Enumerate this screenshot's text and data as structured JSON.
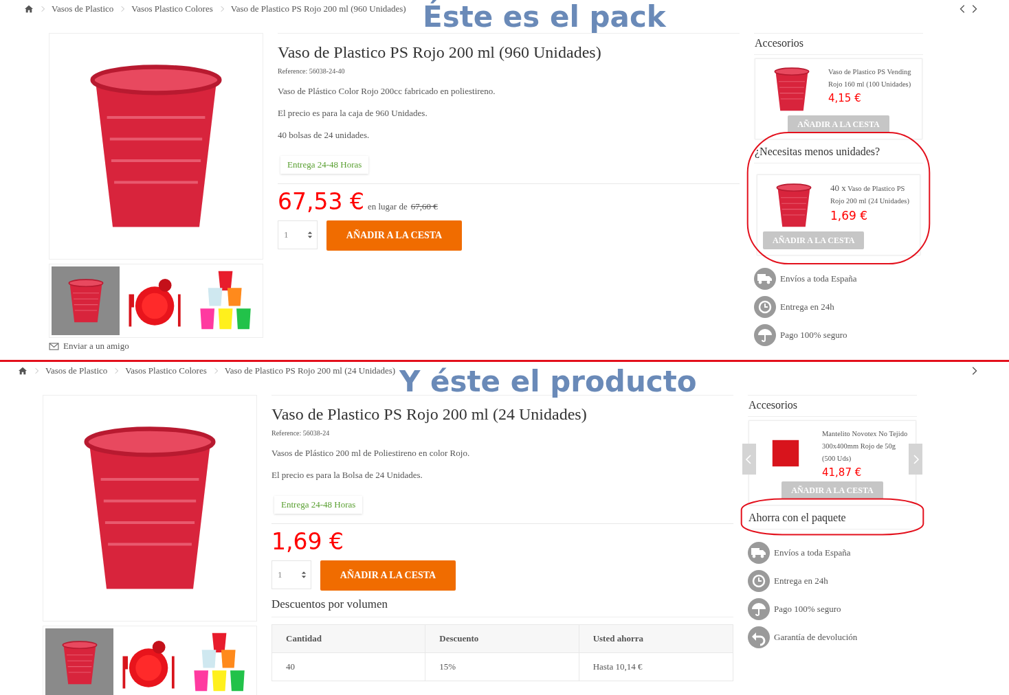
{
  "pages": [
    {
      "breadcrumb": [
        "Vasos de Plastico",
        "Vasos Plastico Colores",
        "Vaso de Plastico PS Rojo 200 ml (960 Unidades)"
      ],
      "nav": {
        "prev": true,
        "next": true
      },
      "annotation": "Éste es el pack",
      "thumbnails": [
        {
          "kind": "cup",
          "selected": true
        },
        {
          "kind": "plate",
          "selected": false
        },
        {
          "kind": "cups",
          "selected": false
        }
      ],
      "send_to_friend": "Enviar a un amigo",
      "product": {
        "title": "Vaso de Plastico PS Rojo 200 ml (960 Unidades)",
        "reference": "Reference: 56038-24-40",
        "description": [
          "Vaso de Plástico Color Rojo 200cc fabricado en poliestireno.",
          "El precio es para la caja de 960 Unidades.",
          "40 bolsas de 24 unidades."
        ],
        "delivery": "Entrega 24-48 Horas",
        "price": "67,53 €",
        "old_price_label": "en lugar de",
        "old_price": "67,60 €",
        "quantity": "1",
        "add_button": "AÑADIR A LA CESTA"
      },
      "sidebar": {
        "accessories_title": "Accesorios",
        "carousel_arrows": false,
        "accessory": {
          "kind": "cup",
          "name": "Vaso de Plastico PS Vending Rojo 160 ml (100 Unidades)",
          "price": "4,15 €",
          "button": "AÑADIR A LA CESTA"
        },
        "pack": {
          "title": "¿Necesitas menos unidades?",
          "circled": true,
          "card": {
            "quantity": "40 x",
            "name": "Vaso de Plastico PS Rojo 200 ml (24 Unidades)",
            "price": "1,69 €",
            "button": "AÑADIR A LA CESTA"
          }
        },
        "features": [
          {
            "kind": "truck",
            "label": "Envíos a toda España"
          },
          {
            "kind": "clock",
            "label": "Entrega en 24h"
          },
          {
            "kind": "umbrella",
            "label": "Pago 100% seguro"
          }
        ]
      }
    },
    {
      "breadcrumb": [
        "Vasos de Plastico",
        "Vasos Plastico Colores",
        "Vaso de Plastico PS Rojo 200 ml (24 Unidades)"
      ],
      "nav": {
        "prev": false,
        "next": true
      },
      "annotation": "Y éste el producto",
      "thumbnails": [
        {
          "kind": "cup",
          "selected": true
        },
        {
          "kind": "plate",
          "selected": false
        },
        {
          "kind": "cups",
          "selected": false
        }
      ],
      "product": {
        "title": "Vaso de Plastico PS Rojo 200 ml (24 Unidades)",
        "reference": "Reference: 56038-24",
        "description": [
          "Vasos de Plástico 200 ml de Poliestireno en color Rojo.",
          "El precio es para la  Bolsa  de 24 Unidades."
        ],
        "delivery": "Entrega 24-48 Horas",
        "price": "1,69 €",
        "quantity": "1",
        "add_button": "AÑADIR A LA CESTA"
      },
      "volume_discounts": {
        "title": "Descuentos por volumen",
        "columns": [
          "Cantidad",
          "Descuento",
          "Usted ahorra"
        ],
        "rows": [
          [
            "40",
            "15%",
            "Hasta 10,14 €"
          ]
        ]
      },
      "sidebar": {
        "accessories_title": "Accesorios",
        "carousel_arrows": true,
        "accessory": {
          "kind": "napkin",
          "name": "Mantelito Novotex No Tejido 300x400mm Rojo de 50g (500 Uds)",
          "price": "41,87 €",
          "button": "AÑADIR A LA CESTA"
        },
        "pack": {
          "title": "Ahorra con el paquete",
          "circled": true
        },
        "features": [
          {
            "kind": "truck",
            "label": "Envíos a toda España"
          },
          {
            "kind": "clock",
            "label": "Entrega en 24h"
          },
          {
            "kind": "umbrella",
            "label": "Pago 100% seguro"
          },
          {
            "kind": "return",
            "label": "Garantía de devolución"
          }
        ]
      }
    }
  ]
}
